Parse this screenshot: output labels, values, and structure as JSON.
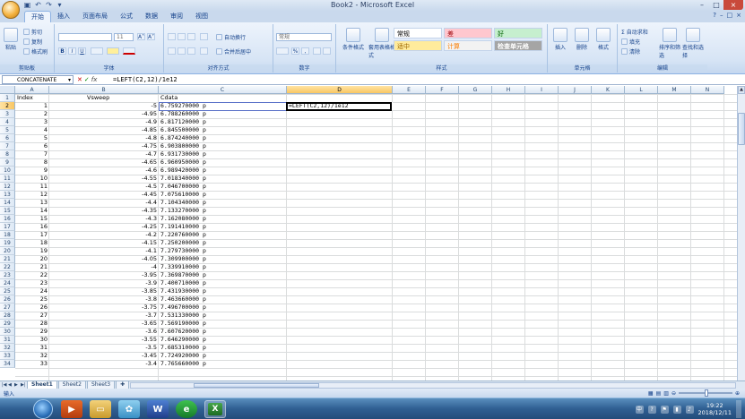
{
  "window": {
    "title": "Book2 - Microsoft Excel",
    "min": "–",
    "max": "□",
    "close": "×"
  },
  "qat": {
    "save": "▣",
    "undo": "↶",
    "redo": "↷",
    "more": "▾"
  },
  "tabs": [
    "开始",
    "插入",
    "页面布局",
    "公式",
    "数据",
    "审阅",
    "视图"
  ],
  "tabs_right": {
    "help": "?",
    "min": "–",
    "restore": "□",
    "close": "×"
  },
  "ribbon": {
    "clipboard": {
      "label": "剪贴板",
      "paste": "粘贴",
      "cut": "剪切",
      "copy": "复制",
      "format_painter": "格式刷"
    },
    "font": {
      "label": "字体",
      "font_name": "",
      "font_size": "11",
      "grow": "A˄",
      "shrink": "A˅",
      "bold": "B",
      "italic": "I",
      "underline": "U"
    },
    "alignment": {
      "label": "对齐方式",
      "wrap": "自动换行",
      "merge": "合并后居中"
    },
    "number": {
      "label": "数字",
      "format": "常规",
      "percent": "%",
      "comma": ","
    },
    "styles": {
      "label": "样式",
      "conditional": "条件格式",
      "table": "套用表格格式",
      "normal": "常规",
      "bad": "差",
      "good": "好",
      "neutral": "适中",
      "calc": "计算",
      "check": "检查单元格"
    },
    "cells": {
      "label": "单元格",
      "insert": "插入",
      "delete": "删除",
      "format": "格式"
    },
    "editing": {
      "label": "编辑",
      "autosum": "Σ 自动求和",
      "fill": "填充",
      "clear": "清除",
      "sort": "排序和筛选",
      "find": "查找和选择"
    }
  },
  "formula_bar": {
    "name_box": "CONCATENATE",
    "cancel": "✕",
    "enter": "✓",
    "fx": "fx",
    "content": "=LEFT(C2,12)/1e12"
  },
  "columns": [
    "A",
    "B",
    "C",
    "D",
    "E",
    "F",
    "G",
    "H",
    "I",
    "J",
    "K",
    "L",
    "M",
    "N"
  ],
  "header_row": {
    "row": "1",
    "a": "Index",
    "b": "Vsweep",
    "c": "Cdata"
  },
  "active_cell_text": "=LEFT(C2,12)/1e12",
  "rows": [
    {
      "r": "2",
      "a": "1",
      "b": "-5",
      "c": "6.759270000 p"
    },
    {
      "r": "3",
      "a": "2",
      "b": "-4.95",
      "c": "6.788260000 p"
    },
    {
      "r": "4",
      "a": "3",
      "b": "-4.9",
      "c": "6.817120000 p"
    },
    {
      "r": "5",
      "a": "4",
      "b": "-4.85",
      "c": "6.845500000 p"
    },
    {
      "r": "6",
      "a": "5",
      "b": "-4.8",
      "c": "6.874240000 p"
    },
    {
      "r": "7",
      "a": "6",
      "b": "-4.75",
      "c": "6.903800000 p"
    },
    {
      "r": "8",
      "a": "7",
      "b": "-4.7",
      "c": "6.931730000 p"
    },
    {
      "r": "9",
      "a": "8",
      "b": "-4.65",
      "c": "6.960950000 p"
    },
    {
      "r": "10",
      "a": "9",
      "b": "-4.6",
      "c": "6.989420000 p"
    },
    {
      "r": "11",
      "a": "10",
      "b": "-4.55",
      "c": "7.018340000 p"
    },
    {
      "r": "12",
      "a": "11",
      "b": "-4.5",
      "c": "7.046700000 p"
    },
    {
      "r": "13",
      "a": "12",
      "b": "-4.45",
      "c": "7.075610000 p"
    },
    {
      "r": "14",
      "a": "13",
      "b": "-4.4",
      "c": "7.104340000 p"
    },
    {
      "r": "15",
      "a": "14",
      "b": "-4.35",
      "c": "7.133270000 p"
    },
    {
      "r": "16",
      "a": "15",
      "b": "-4.3",
      "c": "7.162080000 p"
    },
    {
      "r": "17",
      "a": "16",
      "b": "-4.25",
      "c": "7.191410000 p"
    },
    {
      "r": "18",
      "a": "17",
      "b": "-4.2",
      "c": "7.220760000 p"
    },
    {
      "r": "19",
      "a": "18",
      "b": "-4.15",
      "c": "7.250200000 p"
    },
    {
      "r": "20",
      "a": "19",
      "b": "-4.1",
      "c": "7.279730000 p"
    },
    {
      "r": "21",
      "a": "20",
      "b": "-4.05",
      "c": "7.309900000 p"
    },
    {
      "r": "22",
      "a": "21",
      "b": "-4",
      "c": "7.339910000 p"
    },
    {
      "r": "23",
      "a": "22",
      "b": "-3.95",
      "c": "7.369870000 p"
    },
    {
      "r": "24",
      "a": "23",
      "b": "-3.9",
      "c": "7.400710000 p"
    },
    {
      "r": "25",
      "a": "24",
      "b": "-3.85",
      "c": "7.431930000 p"
    },
    {
      "r": "26",
      "a": "25",
      "b": "-3.8",
      "c": "7.463660000 p"
    },
    {
      "r": "27",
      "a": "26",
      "b": "-3.75",
      "c": "7.496700000 p"
    },
    {
      "r": "28",
      "a": "27",
      "b": "-3.7",
      "c": "7.531330000 p"
    },
    {
      "r": "29",
      "a": "28",
      "b": "-3.65",
      "c": "7.569190000 p"
    },
    {
      "r": "30",
      "a": "29",
      "b": "-3.6",
      "c": "7.607620000 p"
    },
    {
      "r": "31",
      "a": "30",
      "b": "-3.55",
      "c": "7.646290000 p"
    },
    {
      "r": "32",
      "a": "31",
      "b": "-3.5",
      "c": "7.685310000 p"
    },
    {
      "r": "33",
      "a": "32",
      "b": "-3.45",
      "c": "7.724920000 p"
    },
    {
      "r": "34",
      "a": "33",
      "b": "-3.4",
      "c": "7.765660000 p"
    }
  ],
  "sheets": [
    "Sheet1",
    "Sheet2",
    "Sheet3"
  ],
  "status": {
    "mode": "输入"
  },
  "taskbar": {
    "time": "19:22",
    "date": "2018/12/11",
    "tray_lang": "中"
  },
  "colors": {
    "accent": "#15428b",
    "selected_header": "#f9c663",
    "grid": "#dadcdd"
  }
}
